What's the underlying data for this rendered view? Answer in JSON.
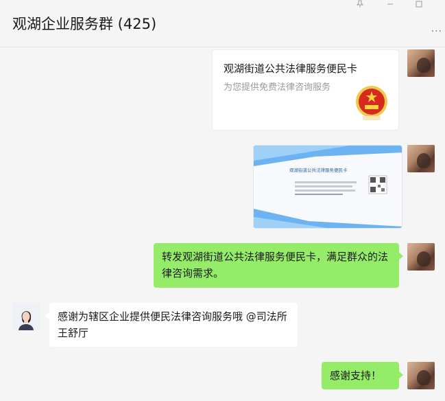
{
  "chat": {
    "title": "观湖企业服务群 (425)"
  },
  "window": {
    "pin_icon": "pin-icon",
    "minimize_icon": "minimize-icon",
    "maximize_icon": "maximize-icon",
    "more_label": "..."
  },
  "messages": {
    "card": {
      "title": "观湖街道公共法律服务便民卡",
      "desc": "为您提供免费法律咨询服务"
    },
    "image": {
      "card_heading": "观湖街道公共法律服务便民卡"
    },
    "forward": {
      "text": "转发观湖街道公共法律服务便民卡，满足群众的法律咨询需求。"
    },
    "thanks": {
      "text": "感谢为辖区企业提供便民法律咨询服务哦 @司法所王舒厅"
    },
    "reply": {
      "text": "感谢支持！"
    }
  },
  "colors": {
    "my_bubble": "#95ec69",
    "other_bubble": "#ffffff",
    "background": "#f5f5f5"
  }
}
